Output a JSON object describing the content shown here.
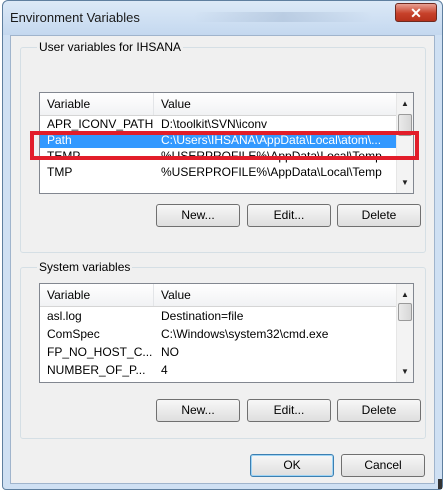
{
  "window": {
    "title": "Environment Variables",
    "close_glyph": "✕"
  },
  "user_vars": {
    "group_label": "User variables for IHSANA",
    "columns": [
      "Variable",
      "Value"
    ],
    "rows": [
      {
        "variable": "APR_ICONV_PATH",
        "value": "D:\\toolkit\\SVN\\iconv"
      },
      {
        "variable": "Path",
        "value": "C:\\Users\\IHSANA\\AppData\\Local\\atom\\..."
      },
      {
        "variable": "TEMP",
        "value": "%USERPROFILE%\\AppData\\Local\\Temp"
      },
      {
        "variable": "TMP",
        "value": "%USERPROFILE%\\AppData\\Local\\Temp"
      }
    ],
    "selected_row": "Path",
    "buttons": {
      "new": "New...",
      "edit": "Edit...",
      "delete": "Delete"
    }
  },
  "system_vars": {
    "group_label": "System variables",
    "columns": [
      "Variable",
      "Value"
    ],
    "rows": [
      {
        "variable": "asl.log",
        "value": "Destination=file"
      },
      {
        "variable": "ComSpec",
        "value": "C:\\Windows\\system32\\cmd.exe"
      },
      {
        "variable": "FP_NO_HOST_C...",
        "value": "NO"
      },
      {
        "variable": "NUMBER_OF_P...",
        "value": "4"
      }
    ],
    "buttons": {
      "new": "New...",
      "edit": "Edit...",
      "delete": "Delete"
    }
  },
  "dialog_buttons": {
    "ok": "OK",
    "cancel": "Cancel"
  },
  "colors": {
    "selection": "#3399ff",
    "highlight_box": "#e21d2a",
    "close_button": "#c7412a"
  },
  "icons": {
    "scroll_up": "▲",
    "scroll_down": "▼"
  }
}
